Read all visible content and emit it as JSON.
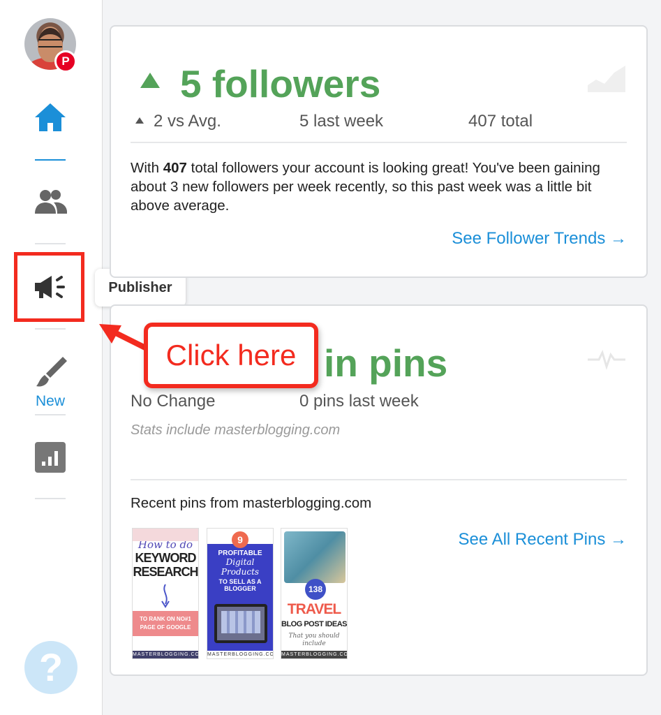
{
  "sidebar": {
    "avatar_badge": "P",
    "new_label": "New",
    "help": "?",
    "icons": [
      "home-icon",
      "audience-icon",
      "megaphone-icon",
      "paintbrush-icon",
      "analytics-icon",
      "help-icon"
    ]
  },
  "tooltip": {
    "label": "Publisher"
  },
  "callout": {
    "text": "Click here"
  },
  "followers_card": {
    "headline": "5 followers",
    "vs_avg": "2 vs Avg.",
    "last_week": "5 last week",
    "total": "407 total",
    "summary_prefix": "With ",
    "summary_bold": "407",
    "summary_rest": " total followers your account is looking great! You've been gaining about 3 new followers per week recently, so this past week was a little bit above average.",
    "trends_link": "See Follower Trends →"
  },
  "pins_card": {
    "headline_suffix": "in pins",
    "change": "No Change",
    "last_week": "0 pins last week",
    "stats_note": "Stats include masterblogging.com",
    "recent_title": "Recent pins from masterblogging.com",
    "all_pins_link": "See All Recent Pins →",
    "pins": [
      {
        "l1": "How to do",
        "l2": "KEYWORD",
        "l3": "RESEARCH",
        "l4": "TO RANK ON NO#1",
        "l5": "PAGE OF GOOGLE",
        "footer": "MASTERBLOGGING.COM"
      },
      {
        "badge": "9",
        "l1": "PROFITABLE",
        "l2": "Digital Products",
        "l3": "TO SELL AS A",
        "l4": "BLOGGER",
        "footer": "MASTERBLOGGING.COM"
      },
      {
        "badge": "138",
        "l1": "TRAVEL",
        "l2": "BLOG POST IDEAS",
        "l3": "That you should",
        "l4": "include",
        "footer": "MASTERBLOGGING.COM"
      }
    ]
  },
  "colors": {
    "accent_green": "#54a359",
    "link_blue": "#1b8fd8",
    "highlight_red": "#f32b1f",
    "pinterest_red": "#e60023"
  }
}
